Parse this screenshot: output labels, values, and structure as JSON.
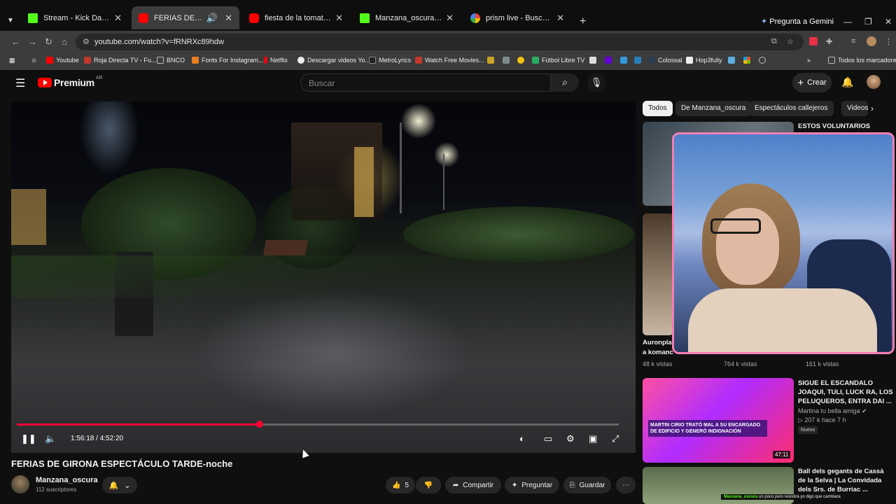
{
  "browser": {
    "tabs": [
      {
        "title": "Stream - Kick Dashboard",
        "icon": "kick-icon"
      },
      {
        "title": "FERIAS DE GIRONA ESPECTÁ",
        "icon": "youtube-icon"
      },
      {
        "title": "fiesta de la tomatina - YouTube",
        "icon": "youtube-icon"
      },
      {
        "title": "Manzana_oscura Clips - Watch",
        "icon": "kick-icon"
      },
      {
        "title": "prism live - Buscar con Google",
        "icon": "google-icon"
      }
    ],
    "gemini": "Pregunta a Gemini",
    "url": "youtube.com/watch?v=fRNRXc89hdw",
    "bookmarks": [
      {
        "label": "Youtube"
      },
      {
        "label": "Roja Directa TV - Fu..."
      },
      {
        "label": "BNCO"
      },
      {
        "label": "Fonts For Instagram..."
      },
      {
        "label": "Netflix"
      },
      {
        "label": "Descargar videos Yo..."
      },
      {
        "label": "MetroLyrics"
      },
      {
        "label": "Watch Free Movies..."
      },
      {
        "label": "Fútbol Libre TV"
      },
      {
        "label": "Colossal"
      },
      {
        "label": "Hop3fully"
      }
    ],
    "all_bookmarks": "Todos los marcadores",
    "colors": {
      "kick": "#53fc18",
      "youtube": "#ff0000"
    }
  },
  "youtube": {
    "logo": "Premium",
    "country": "AR",
    "search_placeholder": "Buscar",
    "create": "Crear"
  },
  "player": {
    "time": "1:56:18 / 4:52:20",
    "progress": 0.404,
    "title": "FERIAS DE GIRONA ESPECTÁCULO TARDE-noche",
    "channel": "Manzana_oscura",
    "subscribers": "112 suscriptores",
    "likes": "5",
    "share": "Compartir",
    "ask": "Preguntar",
    "save": "Guardar"
  },
  "sidebar": {
    "chips": [
      "Todos",
      "De Manzana_oscura",
      "Espectáculos callejeros",
      "Videos"
    ],
    "rec1_title": "ESTOS VOLUNTARIOS",
    "rec_row_partial_title": "Auronpla",
    "rec_row_partial_title2": "a komanc",
    "views": [
      "48 k vistas",
      "764 k vistas",
      "161 k vistas"
    ],
    "rec2": {
      "title": "SIGUE EL ESCANDALO JOAQUI, TULI, LUCK RA, LOS PELUQUEROS, ENTRA DAI ...",
      "channel": "Martina tu bella amiga",
      "meta": "207 k   hace 7 h",
      "badge": "Nuevo",
      "duration": "47:11",
      "thumb_text": "MARTIN CIRIO TRATÓ MAL A SU ENCARGADO DE EDIFICIO Y GENERÓ INDIGNACIÓN"
    },
    "rec3": {
      "title": "Ball dels gegants de Cassà de la Selva | La Convidada dels Srs. de Burriac ..."
    }
  },
  "overlay": {
    "chat_user": "Manzana_oscura",
    "chat_msg": "un poco pero resistirá yo digo que cambiara"
  }
}
